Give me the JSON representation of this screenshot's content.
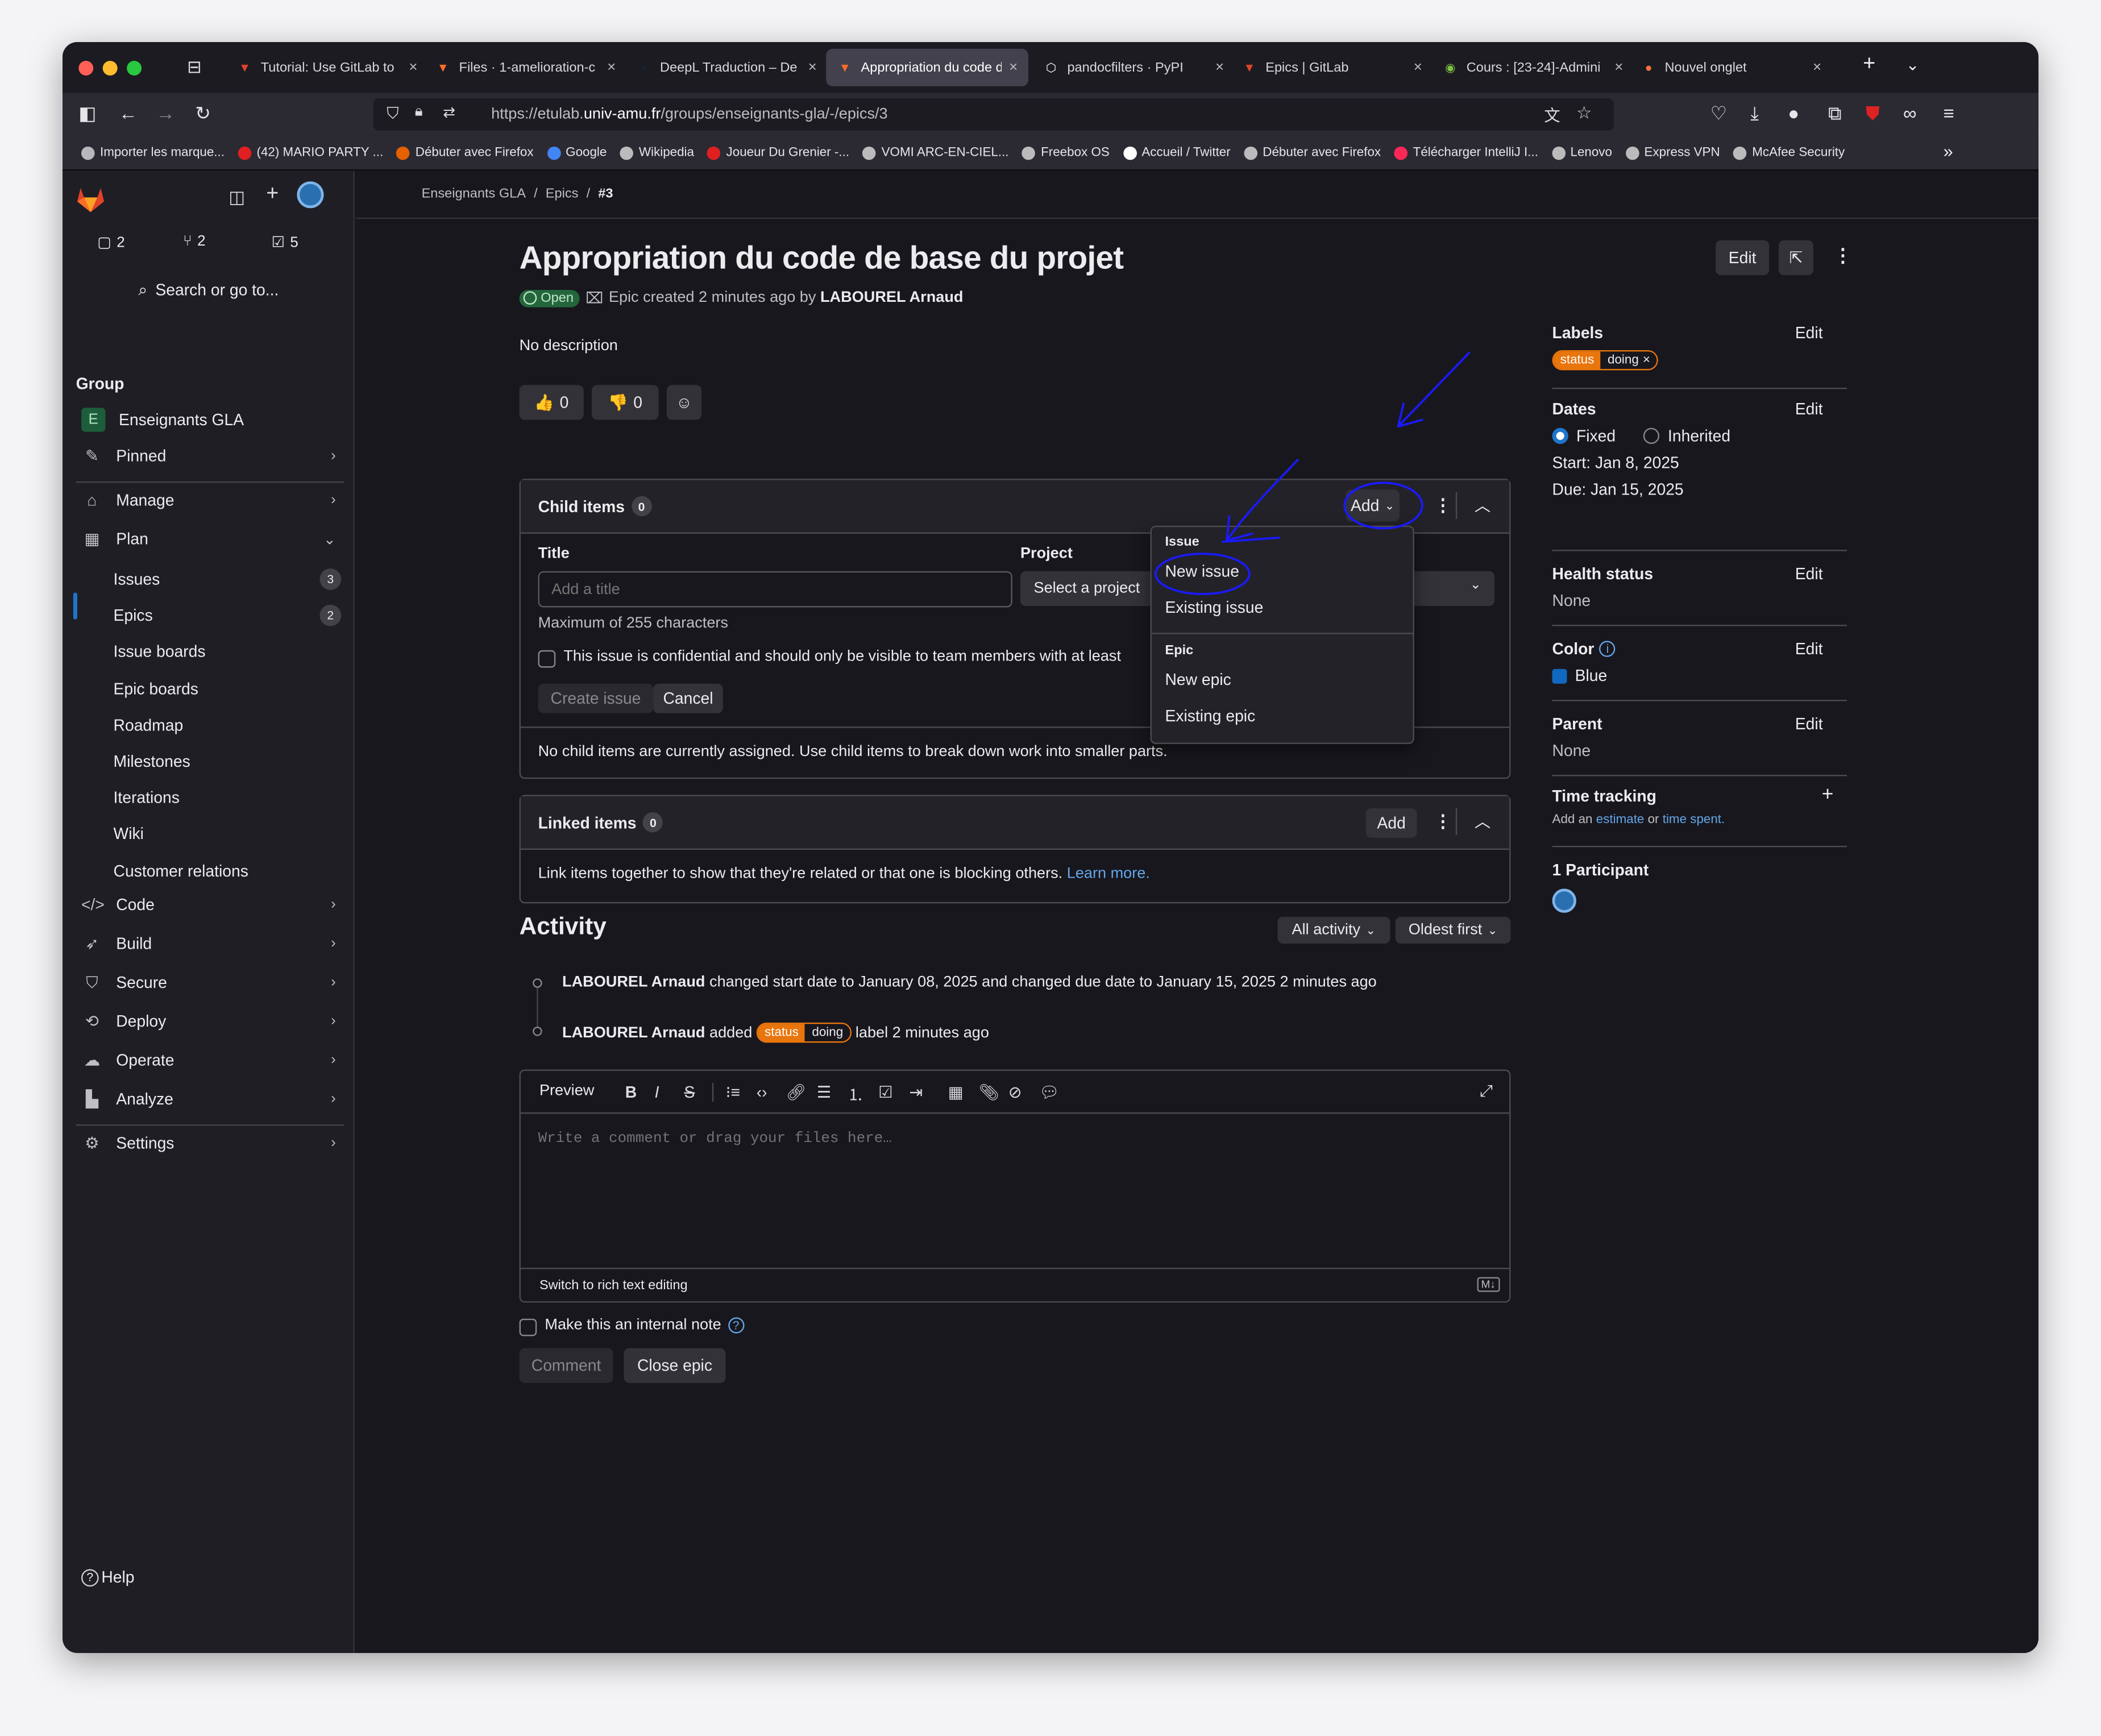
{
  "browser": {
    "tabs": [
      {
        "title": "Tutorial: Use GitLab to ",
        "icon": "gitlab-orange-icon",
        "active": false
      },
      {
        "title": "Files · 1-amelioration-c",
        "icon": "gitlab-icon",
        "active": false
      },
      {
        "title": "DeepL Traduction – De",
        "icon": "deepl-icon",
        "active": false
      },
      {
        "title": "Appropriation du code d",
        "icon": "gitlab-icon",
        "active": true
      },
      {
        "title": "pandocfilters · PyPI",
        "icon": "pypi-icon",
        "active": false
      },
      {
        "title": "Epics | GitLab",
        "icon": "gitlab-orange-icon",
        "active": false
      },
      {
        "title": "Cours : [23-24]-Admini",
        "icon": "moodle-icon",
        "active": false
      },
      {
        "title": "Nouvel onglet",
        "icon": "firefox-icon",
        "active": false
      }
    ],
    "url_prefix": "https://etulab.",
    "url_domain": "univ-amu.fr",
    "url_path": "/groups/enseignants-gla/-/epics/3",
    "bookmarks": [
      "Importer les marque...",
      "(42) MARIO PARTY ...",
      "Débuter avec Firefox",
      "Google",
      "Wikipedia",
      "Joueur Du Grenier -...",
      "VOMI ARC-EN-CIEL...",
      "Freebox OS",
      "Accueil / Twitter",
      "Débuter avec Firefox",
      "Télécharger IntelliJ I...",
      "Lenovo",
      "Express VPN",
      "McAfee Security"
    ],
    "bookmark_colors": [
      "#b8b8bc",
      "#e02020",
      "#e66000",
      "#4285f4",
      "#bbbbbb",
      "#e02020",
      "#bbbbbb",
      "#bbbbbb",
      "#ffffff",
      "#bbbbbb",
      "#fe2857",
      "#bbbbbb",
      "#bbbbbb",
      "#bbbbbb"
    ]
  },
  "sidebar": {
    "counts": {
      "issues": "2",
      "mrs": "2",
      "todos": "5"
    },
    "search": "Search or go to...",
    "group_heading": "Group",
    "group_avatar": "E",
    "group_name": "Enseignants GLA",
    "pinned": "Pinned",
    "manage": "Manage",
    "plan": "Plan",
    "plan_items": [
      {
        "label": "Issues",
        "count": "3"
      },
      {
        "label": "Epics",
        "count": "2"
      },
      {
        "label": "Issue boards"
      },
      {
        "label": "Epic boards"
      },
      {
        "label": "Roadmap"
      },
      {
        "label": "Milestones"
      },
      {
        "label": "Iterations"
      },
      {
        "label": "Wiki"
      },
      {
        "label": "Customer relations"
      }
    ],
    "code": "Code",
    "build": "Build",
    "secure": "Secure",
    "deploy": "Deploy",
    "operate": "Operate",
    "analyze": "Analyze",
    "settings": "Settings",
    "help": "Help"
  },
  "breadcrumb": {
    "group": "Enseignants GLA",
    "section": "Epics",
    "current": "#3"
  },
  "epic": {
    "title": "Appropriation du code de base du projet",
    "status": "Open",
    "meta_prefix": "Epic created 2 minutes ago by",
    "author": "LABOUREL Arnaud",
    "description": "No description",
    "thumbs_up": "0",
    "thumbs_down": "0",
    "edit": "Edit"
  },
  "child_items": {
    "title": "Child items",
    "count": "0",
    "add": "Add",
    "form_title_label": "Title",
    "form_title_placeholder": "Add a title",
    "form_project_label": "Project",
    "form_project_placeholder": "Select a project",
    "max_chars": "Maximum of 255 characters",
    "confidential": "This issue is confidential and should only be visible to team members with at least",
    "create": "Create issue",
    "cancel": "Cancel",
    "empty": "No child items are currently assigned. Use child items to break down work into smaller parts."
  },
  "dropdown": {
    "issue_header": "Issue",
    "new_issue": "New issue",
    "existing_issue": "Existing issue",
    "epic_header": "Epic",
    "new_epic": "New epic",
    "existing_epic": "Existing epic"
  },
  "linked_items": {
    "title": "Linked items",
    "count": "0",
    "add": "Add",
    "text": "Link items together to show that they're related or that one is blocking others.",
    "learn_more": "Learn more."
  },
  "activity": {
    "title": "Activity",
    "filter": "All activity",
    "sort": "Oldest first",
    "events": [
      {
        "author": "LABOUREL Arnaud",
        "text": "changed start date to January 08, 2025 and changed due date to January 15, 2025 2 minutes ago"
      },
      {
        "author": "LABOUREL Arnaud",
        "text_before": "added",
        "text_after": "label 2 minutes ago"
      }
    ]
  },
  "editor": {
    "preview": "Preview",
    "placeholder": "Write a comment or drag your files here…",
    "switch": "Switch to rich text editing",
    "internal_note": "Make this an internal note",
    "comment": "Comment",
    "close_epic": "Close epic"
  },
  "right": {
    "labels_title": "Labels",
    "label_scope": "status",
    "label_value": "doing",
    "dates_title": "Dates",
    "fixed": "Fixed",
    "inherited": "Inherited",
    "start": "Start: Jan 8, 2025",
    "due": "Due: Jan 15, 2025",
    "health_title": "Health status",
    "health_value": "None",
    "color_title": "Color",
    "color_value": "Blue",
    "parent_title": "Parent",
    "parent_value": "None",
    "time_title": "Time tracking",
    "time_prefix": "Add an",
    "time_estimate": "estimate",
    "time_or": "or",
    "time_spent": "time spent.",
    "participants": "1 Participant",
    "edit": "Edit"
  },
  "colors": {
    "accent": "#1068bf",
    "label": "#e9750d",
    "annotation": "#1a1aff",
    "open_badge": "#24663b"
  }
}
